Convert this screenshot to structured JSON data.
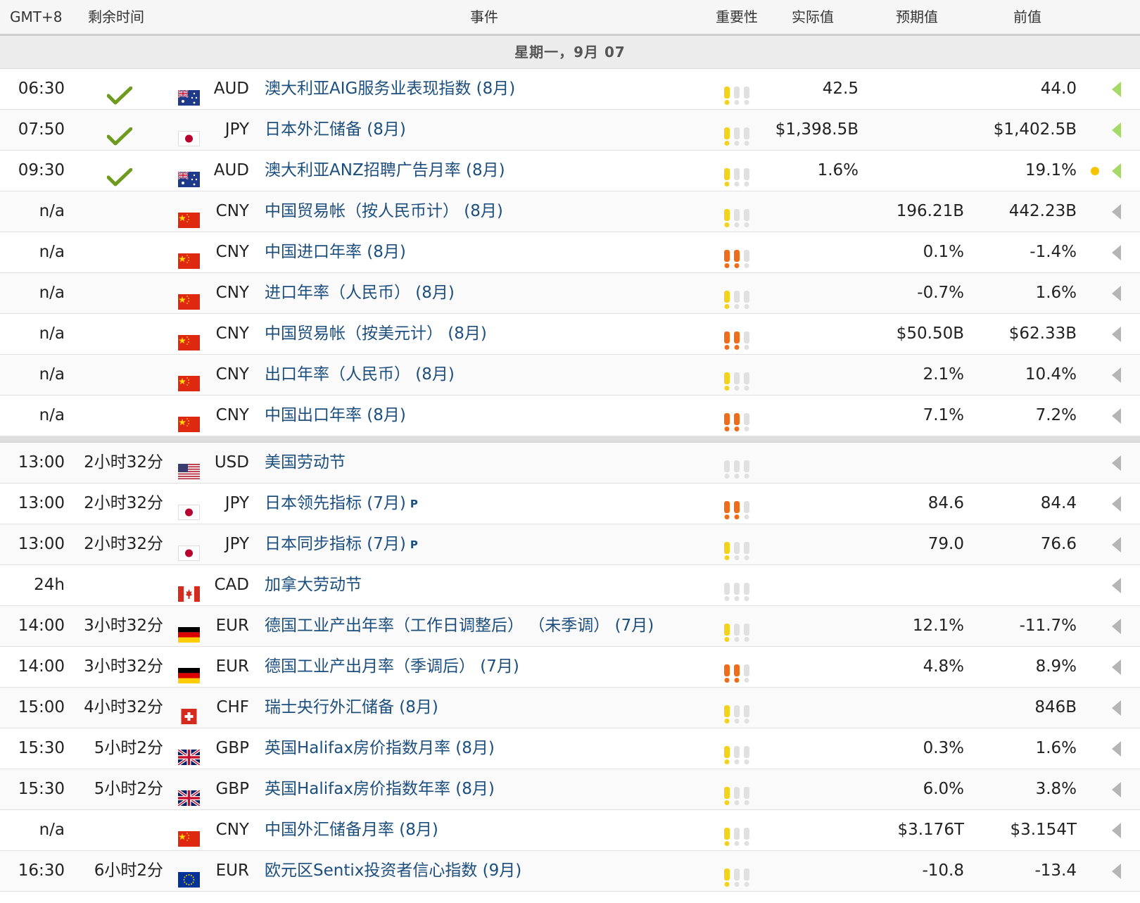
{
  "header": {
    "timezone": "GMT+8",
    "remaining": "剩余时间",
    "event": "事件",
    "importance": "重要性",
    "actual": "实际值",
    "forecast": "预期值",
    "previous": "前值"
  },
  "day_label": "星期一，9月 07",
  "colors": {
    "event_link": "#1c4e7e",
    "bang_yellow": "#f2d21a",
    "bang_orange": "#ef6c1a",
    "bang_grey": "#e0e0e0",
    "arrow_green": "#a6d86b",
    "arrow_grey": "#b5b5b5",
    "check_green": "#6e9a1e"
  },
  "rows": [
    {
      "time": "06:30",
      "remaining": "",
      "released": true,
      "flag": "au",
      "currency": "AUD",
      "event": "澳大利亚AIG服务业表现指数 (8月)",
      "preliminary": false,
      "importance": 1,
      "actual": "42.5",
      "forecast": "",
      "previous": "44.0",
      "note_dot": false,
      "arrow": "green"
    },
    {
      "time": "07:50",
      "remaining": "",
      "released": true,
      "flag": "jp",
      "currency": "JPY",
      "event": "日本外汇储备 (8月)",
      "preliminary": false,
      "importance": 1,
      "actual": "$1,398.5B",
      "forecast": "",
      "previous": "$1,402.5B",
      "note_dot": false,
      "arrow": "green"
    },
    {
      "time": "09:30",
      "remaining": "",
      "released": true,
      "flag": "au",
      "currency": "AUD",
      "event": "澳大利亚ANZ招聘广告月率 (8月)",
      "preliminary": false,
      "importance": 1,
      "actual": "1.6%",
      "forecast": "",
      "previous": "19.1%",
      "note_dot": true,
      "arrow": "green"
    },
    {
      "time": "n/a",
      "remaining": "",
      "released": false,
      "flag": "cn",
      "currency": "CNY",
      "event": "中国贸易帐（按人民币计） (8月)",
      "preliminary": false,
      "importance": 1,
      "actual": "",
      "forecast": "196.21B",
      "previous": "442.23B",
      "note_dot": false,
      "arrow": "grey"
    },
    {
      "time": "n/a",
      "remaining": "",
      "released": false,
      "flag": "cn",
      "currency": "CNY",
      "event": "中国进口年率 (8月)",
      "preliminary": false,
      "importance": 2,
      "actual": "",
      "forecast": "0.1%",
      "previous": "-1.4%",
      "note_dot": false,
      "arrow": "grey"
    },
    {
      "time": "n/a",
      "remaining": "",
      "released": false,
      "flag": "cn",
      "currency": "CNY",
      "event": "进口年率（人民币） (8月)",
      "preliminary": false,
      "importance": 1,
      "actual": "",
      "forecast": "-0.7%",
      "previous": "1.6%",
      "note_dot": false,
      "arrow": "grey"
    },
    {
      "time": "n/a",
      "remaining": "",
      "released": false,
      "flag": "cn",
      "currency": "CNY",
      "event": "中国贸易帐（按美元计） (8月)",
      "preliminary": false,
      "importance": 2,
      "actual": "",
      "forecast": "$50.50B",
      "previous": "$62.33B",
      "note_dot": false,
      "arrow": "grey"
    },
    {
      "time": "n/a",
      "remaining": "",
      "released": false,
      "flag": "cn",
      "currency": "CNY",
      "event": "出口年率（人民币） (8月)",
      "preliminary": false,
      "importance": 1,
      "actual": "",
      "forecast": "2.1%",
      "previous": "10.4%",
      "note_dot": false,
      "arrow": "grey"
    },
    {
      "time": "n/a",
      "remaining": "",
      "released": false,
      "flag": "cn",
      "currency": "CNY",
      "event": "中国出口年率 (8月)",
      "preliminary": false,
      "importance": 2,
      "actual": "",
      "forecast": "7.1%",
      "previous": "7.2%",
      "note_dot": false,
      "arrow": "grey",
      "separator_after": true
    },
    {
      "time": "13:00",
      "remaining": "2小时32分",
      "released": false,
      "flag": "us",
      "currency": "USD",
      "event": "美国劳动节",
      "preliminary": false,
      "importance": 0,
      "actual": "",
      "forecast": "",
      "previous": "",
      "note_dot": false,
      "arrow": "grey"
    },
    {
      "time": "13:00",
      "remaining": "2小时32分",
      "released": false,
      "flag": "jp",
      "currency": "JPY",
      "event": "日本领先指标 (7月)",
      "preliminary": true,
      "importance": 2,
      "actual": "",
      "forecast": "84.6",
      "previous": "84.4",
      "note_dot": false,
      "arrow": "grey"
    },
    {
      "time": "13:00",
      "remaining": "2小时32分",
      "released": false,
      "flag": "jp",
      "currency": "JPY",
      "event": "日本同步指标 (7月)",
      "preliminary": true,
      "importance": 1,
      "actual": "",
      "forecast": "79.0",
      "previous": "76.6",
      "note_dot": false,
      "arrow": "grey"
    },
    {
      "time": "24h",
      "remaining": "",
      "released": false,
      "flag": "ca",
      "currency": "CAD",
      "event": "加拿大劳动节",
      "preliminary": false,
      "importance": 0,
      "actual": "",
      "forecast": "",
      "previous": "",
      "note_dot": false,
      "arrow": "grey"
    },
    {
      "time": "14:00",
      "remaining": "3小时32分",
      "released": false,
      "flag": "de",
      "currency": "EUR",
      "event": "德国工业产出年率（工作日调整后） （未季调） (7月)",
      "preliminary": false,
      "importance": 1,
      "actual": "",
      "forecast": "12.1%",
      "previous": "-11.7%",
      "note_dot": false,
      "arrow": "grey"
    },
    {
      "time": "14:00",
      "remaining": "3小时32分",
      "released": false,
      "flag": "de",
      "currency": "EUR",
      "event": "德国工业产出月率（季调后） (7月)",
      "preliminary": false,
      "importance": 2,
      "actual": "",
      "forecast": "4.8%",
      "previous": "8.9%",
      "note_dot": false,
      "arrow": "grey"
    },
    {
      "time": "15:00",
      "remaining": "4小时32分",
      "released": false,
      "flag": "ch",
      "currency": "CHF",
      "event": "瑞士央行外汇储备 (8月)",
      "preliminary": false,
      "importance": 1,
      "actual": "",
      "forecast": "",
      "previous": "846B",
      "note_dot": false,
      "arrow": "grey"
    },
    {
      "time": "15:30",
      "remaining": "5小时2分",
      "released": false,
      "flag": "gb",
      "currency": "GBP",
      "event": "英国Halifax房价指数月率 (8月)",
      "preliminary": false,
      "importance": 1,
      "actual": "",
      "forecast": "0.3%",
      "previous": "1.6%",
      "note_dot": false,
      "arrow": "grey"
    },
    {
      "time": "15:30",
      "remaining": "5小时2分",
      "released": false,
      "flag": "gb",
      "currency": "GBP",
      "event": "英国Halifax房价指数年率 (8月)",
      "preliminary": false,
      "importance": 1,
      "actual": "",
      "forecast": "6.0%",
      "previous": "3.8%",
      "note_dot": false,
      "arrow": "grey"
    },
    {
      "time": "n/a",
      "remaining": "",
      "released": false,
      "flag": "cn",
      "currency": "CNY",
      "event": "中国外汇储备月率 (8月)",
      "preliminary": false,
      "importance": 1,
      "actual": "",
      "forecast": "$3.176T",
      "previous": "$3.154T",
      "note_dot": false,
      "arrow": "grey"
    },
    {
      "time": "16:30",
      "remaining": "6小时2分",
      "released": false,
      "flag": "eu",
      "currency": "EUR",
      "event": "欧元区Sentix投资者信心指数 (9月)",
      "preliminary": false,
      "importance": 1,
      "actual": "",
      "forecast": "-10.8",
      "previous": "-13.4",
      "note_dot": false,
      "arrow": "grey"
    }
  ],
  "preliminary_mark": "P"
}
